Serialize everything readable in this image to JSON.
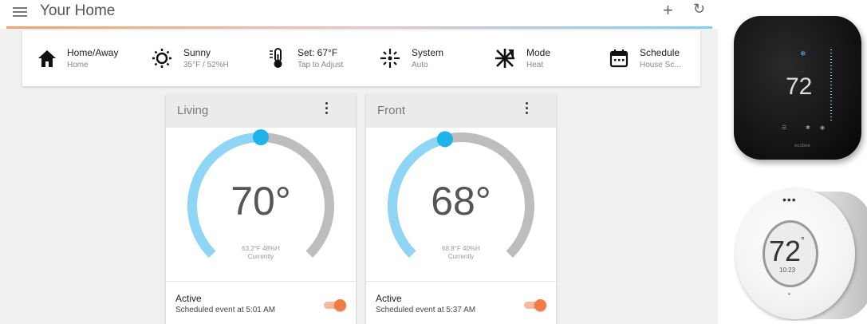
{
  "header": {
    "title": "Your Home",
    "add_icon": "+",
    "refresh_icon": "C"
  },
  "status": [
    {
      "icon": "home-icon",
      "label": "Home/Away",
      "sub": "Home"
    },
    {
      "icon": "sun-icon",
      "label": "Sunny",
      "sub": "35°F / 52%H"
    },
    {
      "icon": "thermometer-icon",
      "label": "Set: 67°F",
      "sub": "Tap to Adjust"
    },
    {
      "icon": "system-icon",
      "label": "System",
      "sub": "Auto"
    },
    {
      "icon": "mode-heat-icon",
      "label": "Mode",
      "sub": "Heat"
    },
    {
      "icon": "calendar-icon",
      "label": "Schedule",
      "sub": "House Sc..."
    }
  ],
  "cards": [
    {
      "name": "Living",
      "temperature": "70°",
      "reading": "63.2°F   48%H",
      "currently": "Currently",
      "active_label": "Active",
      "schedule": "Scheduled event at 5:01 AM",
      "toggle_on": true,
      "setpoint_fraction": 0.5
    },
    {
      "name": "Front",
      "temperature": "68°",
      "reading": "68.8°F   40%H",
      "currently": "Currently",
      "active_label": "Active",
      "schedule": "Scheduled event at 5:37 AM",
      "toggle_on": true,
      "setpoint_fraction": 0.45
    }
  ],
  "devices": {
    "ecobee": {
      "temperature": "72",
      "brand": "ecobee"
    },
    "round": {
      "temperature": "72",
      "time": "10:23"
    }
  },
  "colors": {
    "accent_blue": "#8fd5f5",
    "knob_blue": "#1fb3ea",
    "arc_grey": "#bdbdbd",
    "toggle_orange": "#f07c43"
  }
}
